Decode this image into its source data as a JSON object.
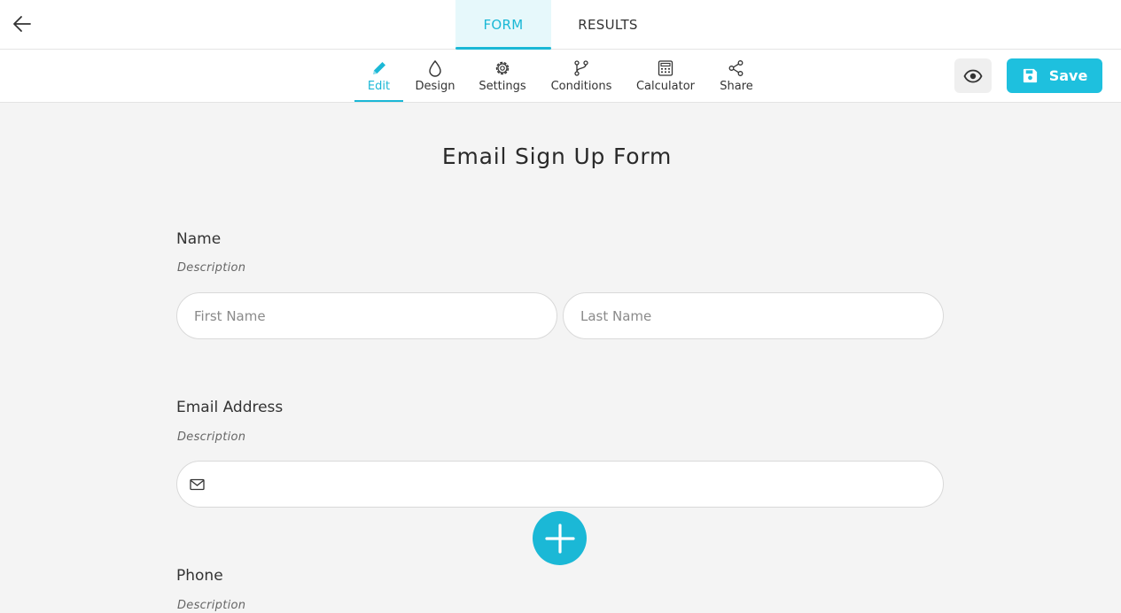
{
  "header": {
    "back_icon": "arrow-left-icon",
    "tabs": [
      {
        "label": "FORM",
        "active": true
      },
      {
        "label": "RESULTS",
        "active": false
      }
    ]
  },
  "toolbar": {
    "items": [
      {
        "label": "Edit",
        "icon": "pencil-icon",
        "active": true
      },
      {
        "label": "Design",
        "icon": "droplet-icon",
        "active": false
      },
      {
        "label": "Settings",
        "icon": "gear-icon",
        "active": false
      },
      {
        "label": "Conditions",
        "icon": "branch-icon",
        "active": false
      },
      {
        "label": "Calculator",
        "icon": "calculator-icon",
        "active": false
      },
      {
        "label": "Share",
        "icon": "share-icon",
        "active": false
      }
    ],
    "preview_icon": "eye-icon",
    "save_label": "Save",
    "save_icon": "floppy-disk-icon"
  },
  "form": {
    "title": "Email Sign Up Form",
    "fields": [
      {
        "label": "Name",
        "description": "Description",
        "inputs": [
          {
            "placeholder": "First Name",
            "value": ""
          },
          {
            "placeholder": "Last Name",
            "value": ""
          }
        ]
      },
      {
        "label": "Email Address",
        "description": "Description",
        "icon": "envelope-icon",
        "value": ""
      },
      {
        "label": "Phone",
        "description": "Description"
      }
    ],
    "add_icon": "plus-icon"
  },
  "colors": {
    "accent": "#1bb8d6",
    "save_button": "#1ec0de",
    "background": "#f4f4f4"
  }
}
